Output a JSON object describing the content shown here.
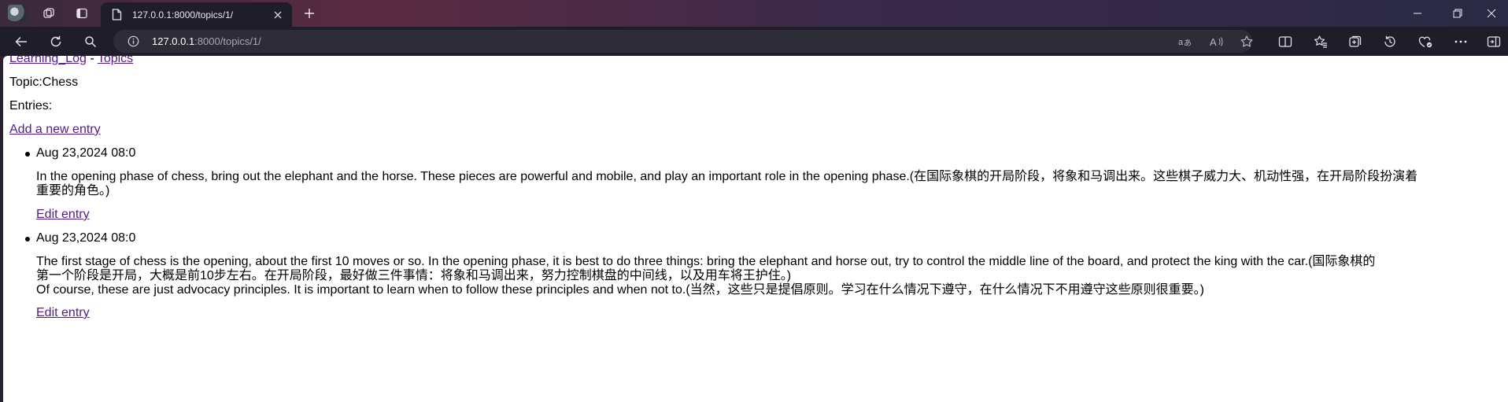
{
  "browser": {
    "tab": {
      "title": "127.0.0.1:8000/topics/1/"
    },
    "address": {
      "host": "127.0.0.1",
      "path": ":8000/topics/1/"
    }
  },
  "page": {
    "nav": {
      "home_label": "Learning_Log",
      "separator": "-",
      "topics_label": "Topics"
    },
    "topic_heading": "Topic:Chess",
    "entries_heading": "Entries:",
    "add_entry_label": "Add a new entry",
    "entries": [
      {
        "date": "Aug 23,2024 08:0",
        "text_lines": [
          "In the opening phase of chess, bring out the elephant and the horse. These pieces are powerful and mobile, and play an important role in the opening phase.(在国际象棋的开局阶段，将象和马调出来。这些棋子威力大、机动性强，在开局阶段扮演着",
          "重要的角色。)"
        ],
        "edit_label": "Edit entry"
      },
      {
        "date": "Aug 23,2024 08:0",
        "text_lines": [
          "The first stage of chess is the opening, about the first 10 moves or so. In the opening phase, it is best to do three things: bring the elephant and horse out, try to control the middle line of the board, and protect the king with the car.(国际象棋的",
          "第一个阶段是开局，大概是前10步左右。在开局阶段，最好做三件事情：将象和马调出来，努力控制棋盘的中间线，以及用车将王护住。)",
          "Of course, these are just advocacy principles. It is important to learn when to follow these principles and when not to.(当然，这些只是提倡原则。学习在什么情况下遵守，在什么情况下不用遵守这些原则很重要。)"
        ],
        "edit_label": "Edit entry"
      }
    ]
  }
}
